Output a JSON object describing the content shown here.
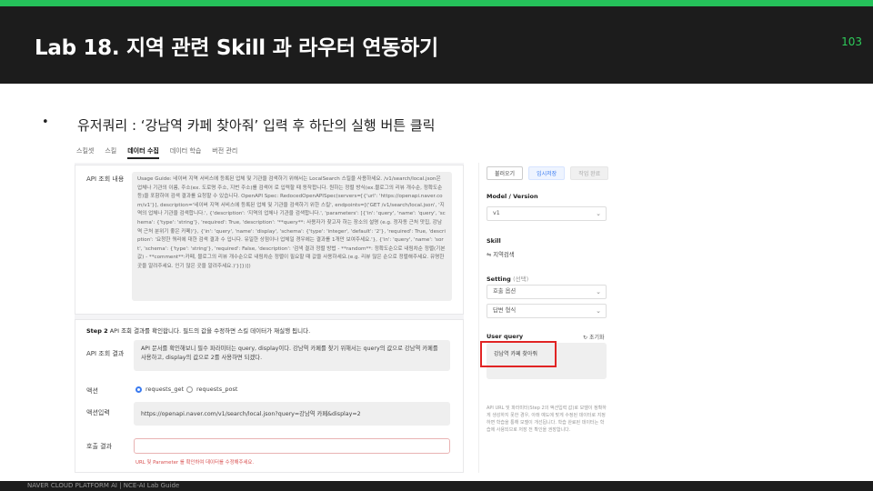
{
  "slide": {
    "title": "Lab 18. 지역 관련 Skill 과 라우터 연동하기",
    "page_number": "103",
    "bullet": "•",
    "instruction": "유저쿼리 : ‘강남역 카페 찾아줘’ 입력 후 하단의 실행 버튼 클릭",
    "footer": "NAVER CLOUD PLATFORM AI  |  NCE-AI Lab Guide"
  },
  "colors": {
    "accent_green": "#25c15a",
    "header_bg": "#1c1c1c",
    "highlight_red": "#e12424",
    "primary_blue": "#3a7bf0"
  },
  "tabs": [
    {
      "label": "스킬셋",
      "active": false
    },
    {
      "label": "스킬",
      "active": false
    },
    {
      "label": "데이터 수집",
      "active": true
    },
    {
      "label": "데이터 학습",
      "active": false
    },
    {
      "label": "버전 관리",
      "active": false
    }
  ],
  "step1": {
    "label": "API 조회 내용",
    "usage_text": "Usage Guide: 네이버 지역 서비스에 등록된 업체 및 기관을 검색하기 위해서는 LocalSearch 스킬을 사용하세요. /v1/search/local.json은 업체나 기관의 이름, 주소(ex. 도로명 주소, 지번 주소)를 검색어 로 입력할 때 동작합니다. 원하는 정렬 방식(ex.블로그의 리뷰 개수순, 정확도순 등)을 포함하여 검색 결과를 요청할 수 있습니다. OpenAPI Spec: RedocedOpenAPISpec(servers=[{'url': 'https://openapi.naver.com/v1'}], description='네이버 지역 서비스에 등록된 업체 및 기관을 검색하기 위한 스킬', endpoints=[('GET /v1/search/local.json', '지역의 업체나 기관을 검색합니다.', {'description': '지역의 업체나 기관을 검색합니다.', 'parameters': [{'in': 'query', 'name': 'query', 'schema': {'type': 'string'}, 'required': True, 'description': '**query**: 사용자가 찾고자 하는 장소의 설명 (e.g. 정자동 근처 맛집, 강남역 근처 분위기 좋은 카페)'}, {'in': 'query', 'name': 'display', 'schema': {'type': 'integer', 'default': '2'}, 'required': True, 'description': '요청한 쿼리에 대한 검색 결과 수 입니다. 유일한 상점이나 업체일 경우에는 결과를 1개만 보여주세요.'}, {'in': 'query', 'name': 'sort', 'schema': {'type': 'string'}, 'required': False, 'description': '검색 결과 정렬 방법 - **random**: 정확도순으로 내림차순 정렬(기본값) - **comment**:카페, 블로그의 리뷰 개수순으로 내림차순 정렬이 필요할 때 값을 사용하세요.(e.g. 리뷰 많은 순으로 정렬해주세요. 유명한 곳을 알려주세요. 인기 많은 곳을 알려주세요.)'}]})])"
  },
  "step2": {
    "step_label": "Step 2",
    "step_desc": "API 조회 결과를 확인합니다. 필드의 값을 수정하면 스킬 데이터가 재실행 됩니다.",
    "result_label": "API 조회 결과",
    "result_text": "API 문서를 확인해보니 필수 파라미터는 query, display이다. 강남역 카페를 찾기 위해서는 query의 값으로 강남역 카페를 사용하고, display의 값으로 2를 사용하면 되겠다.",
    "action_label": "액션",
    "action_options": [
      "requests_get",
      "requests_post"
    ],
    "action_input_label": "액션입력",
    "action_input_value": "https://openapi.naver.com/v1/search/local.json?query=강남역 카페&display=2",
    "call_result_label": "호출 결과",
    "error_text": "URL 및 Parameter 를 확인하여 데이터를 수정해주세요."
  },
  "right_panel": {
    "load_button": "불러오기",
    "temp_save_button": "임시저장",
    "run_button": "작업 완료",
    "model_label": "Model / Version",
    "model_value": "v1",
    "skill_label": "Skill",
    "skill_value": "지역검색",
    "setting_label": "Setting",
    "setting_sub": "(선택)",
    "setting_call_option": "호출 옵션",
    "setting_answer_format": "답변 형식",
    "user_query_label": "User query",
    "reset_label": "초기화",
    "user_query_value": "강남역 카페 찾아줘",
    "help_text": "API URL 및 파라미터(Step 2의 액션입력 값)로 모델이 정확하게 생성하지 못한 경우, 아래 예도에 맞게 수정된 데이터로 지정하면 학습을 통해 모델이 개선됩니다. 학습 완료된 데이터는 학습에 사용되므로 저장 전 확인을 권장합니다."
  }
}
